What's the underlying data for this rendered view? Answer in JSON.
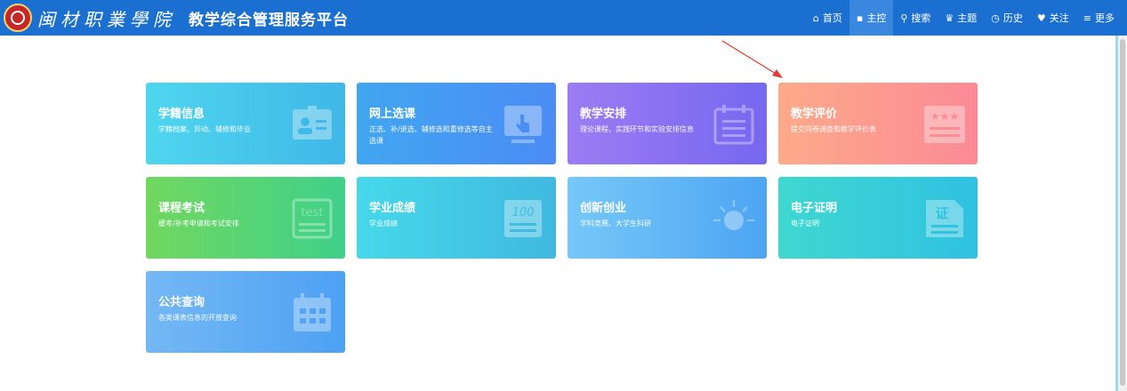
{
  "header": {
    "school_name": "闽材职業學院",
    "platform_title": "教学综合管理服务平台"
  },
  "nav": [
    {
      "icon": "home-icon",
      "glyph": "⌂",
      "label": "首页"
    },
    {
      "icon": "grid-icon",
      "glyph": "▪",
      "label": "主控"
    },
    {
      "icon": "search-icon",
      "glyph": "⚲",
      "label": "搜索"
    },
    {
      "icon": "shirt-icon",
      "glyph": "♛",
      "label": "主题"
    },
    {
      "icon": "clock-icon",
      "glyph": "◷",
      "label": "历史"
    },
    {
      "icon": "heart-icon",
      "glyph": "♥",
      "label": "关注"
    },
    {
      "icon": "menu-icon",
      "glyph": "≡",
      "label": "更多"
    }
  ],
  "cards": [
    {
      "title": "学籍信息",
      "desc": "学籍档案、异动、辅修和毕业",
      "icon": "id-card-icon",
      "from": "#4fd6ee",
      "to": "#3fb7e8"
    },
    {
      "title": "网上选课",
      "desc": "正选、补/退选、辅修选和重修选等自主选课",
      "icon": "touch-screen-icon",
      "from": "#41a6f0",
      "to": "#4b8cf5"
    },
    {
      "title": "教学安排",
      "desc": "理论课程、实践环节和实验安排信息",
      "icon": "calendar-list-icon",
      "from": "#9c7cf3",
      "to": "#7667f0"
    },
    {
      "title": "教学评价",
      "desc": "提交问卷调查和教学评价表",
      "icon": "rating-stars-icon",
      "from": "#fdaa8a",
      "to": "#fb8a96"
    },
    {
      "title": "课程考试",
      "desc": "缓考/补考申请和考试安排",
      "icon": "test-paper-icon",
      "from": "#71d860",
      "to": "#3fd08a"
    },
    {
      "title": "学业成绩",
      "desc": "学业成绩",
      "icon": "score-sheet-icon",
      "from": "#46d8ea",
      "to": "#3fb9e0"
    },
    {
      "title": "创新创业",
      "desc": "学科竞赛、大学生科研",
      "icon": "lightbulb-icon",
      "from": "#76c8f8",
      "to": "#4da5f2"
    },
    {
      "title": "电子证明",
      "desc": "电子证明",
      "icon": "certificate-icon",
      "from": "#3fd8d0",
      "to": "#2fc1e2"
    },
    {
      "title": "公共查询",
      "desc": "各类课表信息的开放查询",
      "icon": "calendar-grid-icon",
      "from": "#74b8f4",
      "to": "#4da1f4"
    }
  ],
  "colors": {
    "header_bg": "#1b6fd1",
    "nav_active_bg": "#3a87e0",
    "annotation_arrow": "#e53935"
  }
}
